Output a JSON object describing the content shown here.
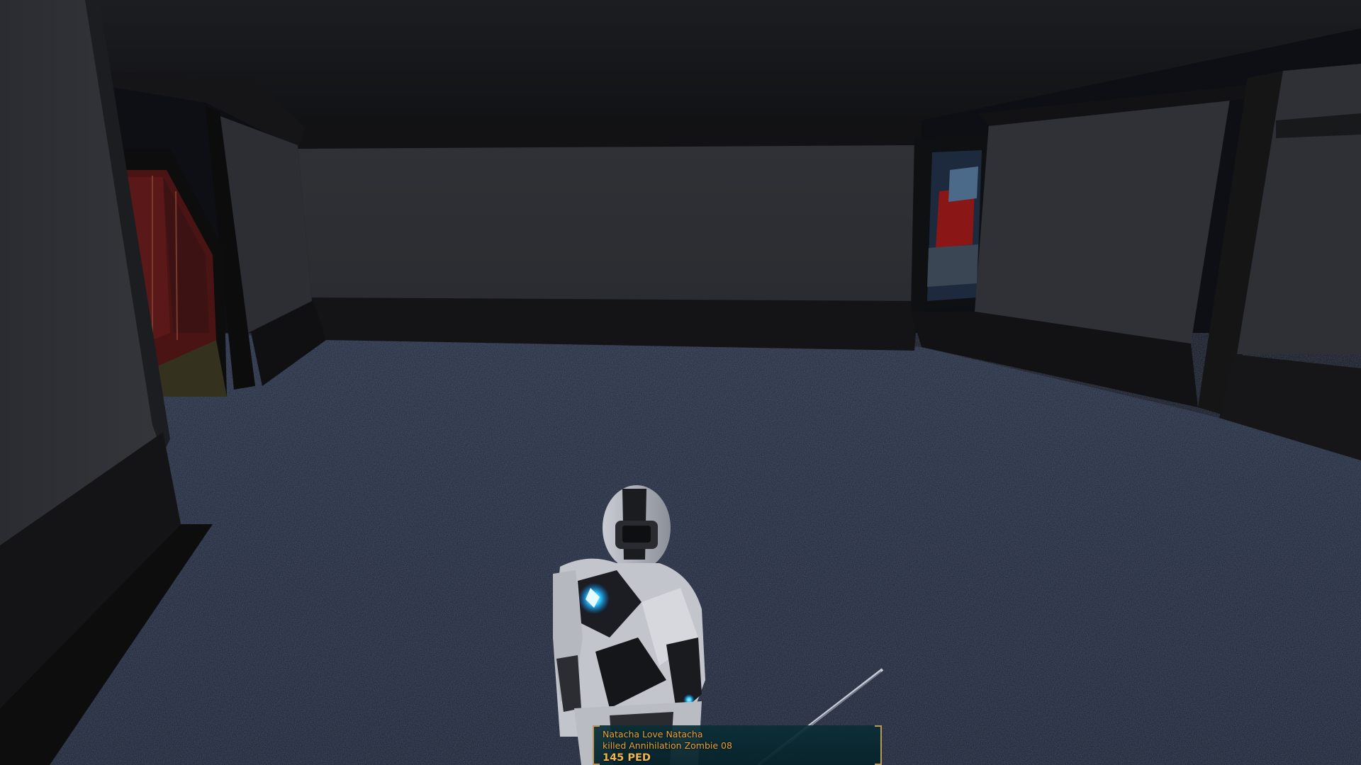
{
  "hud": {
    "global_notification": {
      "player": "Natacha Love Natacha",
      "event": "killed Annihilation Zombie 08",
      "value": "145 PED"
    }
  },
  "colors": {
    "notification_text": "#e8a33a",
    "notification_bg": "#0a2e36",
    "notification_frame": "#b79a58",
    "carpet": "#1e2536",
    "wall": "#2e3035",
    "ceiling": "#141518"
  }
}
